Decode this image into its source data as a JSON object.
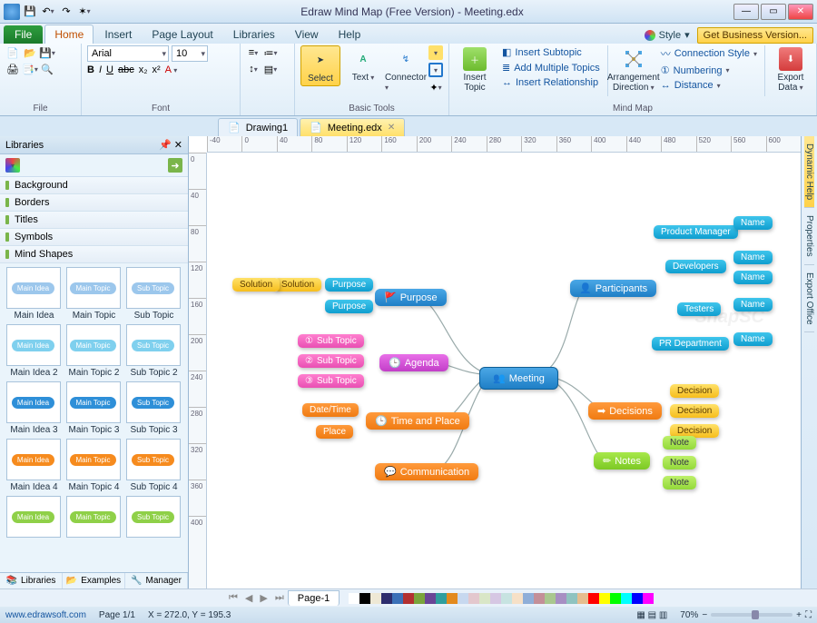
{
  "window": {
    "title": "Edraw Mind Map (Free Version) - Meeting.edx"
  },
  "tabs": {
    "file": "File",
    "items": [
      "Home",
      "Insert",
      "Page Layout",
      "Libraries",
      "View",
      "Help"
    ],
    "active": "Home",
    "style": "Style",
    "getBiz": "Get Business Version..."
  },
  "ribbon": {
    "file": {
      "label": "File"
    },
    "font": {
      "label": "Font",
      "family": "Arial",
      "size": "10",
      "bold": "B",
      "italic": "I",
      "underline": "U",
      "strike": "abc",
      "sub": "x₂",
      "sup": "x²"
    },
    "basic": {
      "label": "Basic Tools",
      "select": "Select",
      "text": "Text",
      "connector": "Connector"
    },
    "mind": {
      "label": "Mind Map",
      "insertTopic": "Insert\nTopic",
      "insertSub": "Insert Subtopic",
      "addMult": "Add Multiple Topics",
      "insertRel": "Insert Relationship",
      "arrange": "Arrangement\nDirection",
      "connStyle": "Connection Style",
      "numbering": "Numbering",
      "distance": "Distance",
      "export": "Export\nData"
    }
  },
  "doctabs": [
    {
      "label": "Drawing1",
      "active": false
    },
    {
      "label": "Meeting.edx",
      "active": true
    }
  ],
  "libraries": {
    "title": "Libraries",
    "cats": [
      "Background",
      "Borders",
      "Titles",
      "Symbols",
      "Mind Shapes"
    ],
    "shapes": [
      {
        "label": "Main Idea",
        "pill": "Main Idea",
        "color": "#9cc7ec"
      },
      {
        "label": "Main Topic",
        "pill": "Main Topic",
        "color": "#9cc7ec"
      },
      {
        "label": "Sub Topic",
        "pill": "Sub Topic",
        "color": "#9cc7ec"
      },
      {
        "label": "Main Idea 2",
        "pill": "Main Idea",
        "color": "#7fd0ee"
      },
      {
        "label": "Main Topic 2",
        "pill": "Main Topic",
        "color": "#7fd0ee"
      },
      {
        "label": "Sub Topic 2",
        "pill": "Sub Topic",
        "color": "#7fd0ee"
      },
      {
        "label": "Main Idea 3",
        "pill": "Main Idea",
        "color": "#2e8fd8"
      },
      {
        "label": "Main Topic 3",
        "pill": "Main Topic",
        "color": "#2e8fd8"
      },
      {
        "label": "Sub Topic 3",
        "pill": "Sub Topic",
        "color": "#2e8fd8"
      },
      {
        "label": "Main Idea 4",
        "pill": "Main Idea",
        "color": "#f68b1e"
      },
      {
        "label": "Main Topic 4",
        "pill": "Main Topic",
        "color": "#f68b1e"
      },
      {
        "label": "Sub Topic 4",
        "pill": "Sub Topic",
        "color": "#f68b1e"
      },
      {
        "label": "",
        "pill": "Main Idea",
        "color": "#8fd048"
      },
      {
        "label": "",
        "pill": "Main Topic",
        "color": "#8fd048"
      },
      {
        "label": "",
        "pill": "Sub Topic",
        "color": "#8fd048"
      }
    ],
    "foot": [
      "Libraries",
      "Examples",
      "Manager"
    ]
  },
  "ruler_h": [
    "-40",
    "0",
    "40",
    "80",
    "120",
    "160",
    "200",
    "240",
    "280",
    "320",
    "360",
    "400",
    "440",
    "480",
    "520",
    "560",
    "600"
  ],
  "ruler_v": [
    "0",
    "40",
    "80",
    "120",
    "160",
    "200",
    "240",
    "280",
    "320",
    "360",
    "400"
  ],
  "pagetab": "Page-1",
  "map": {
    "center": "Meeting",
    "purpose": "Purpose",
    "purpose1": "Purpose",
    "purpose2": "Purpose",
    "solution": "Solution",
    "solutionSub": "Solution",
    "agenda": "Agenda",
    "sub1": "Sub Topic",
    "sub2": "Sub Topic",
    "sub3": "Sub Topic",
    "time": "Time and Place",
    "datetime": "Date/Time",
    "place": "Place",
    "comm": "Communication",
    "participants": "Participants",
    "pm": "Product Manager",
    "dev": "Developers",
    "test": "Testers",
    "pr": "PR Department",
    "name": "Name",
    "decisions": "Decisions",
    "decision": "Decision",
    "notes": "Notes",
    "note": "Note"
  },
  "rightstrip": [
    "Dynamic Help",
    "Properties",
    "Export Office"
  ],
  "palette": [
    "#ffffff",
    "#000000",
    "#eee8d5",
    "#2d2d6e",
    "#3b70b7",
    "#b33030",
    "#7aa43b",
    "#6a4596",
    "#2f9e9e",
    "#e38a1e",
    "#c7d8ef",
    "#e3c7cd",
    "#d9e6c7",
    "#d6c7e3",
    "#c7e3e1",
    "#f6e0c7",
    "#8faed8",
    "#c38f98",
    "#a9c78f",
    "#a78fc3",
    "#8fc3c0",
    "#e6bd8f",
    "#ff0000",
    "#ffff00",
    "#00ff00",
    "#00ffff",
    "#0000ff",
    "#ff00ff"
  ],
  "status": {
    "url": "www.edrawsoft.com",
    "page": "Page 1/1",
    "coords": "X = 272.0, Y = 195.3",
    "zoom": "70%"
  }
}
